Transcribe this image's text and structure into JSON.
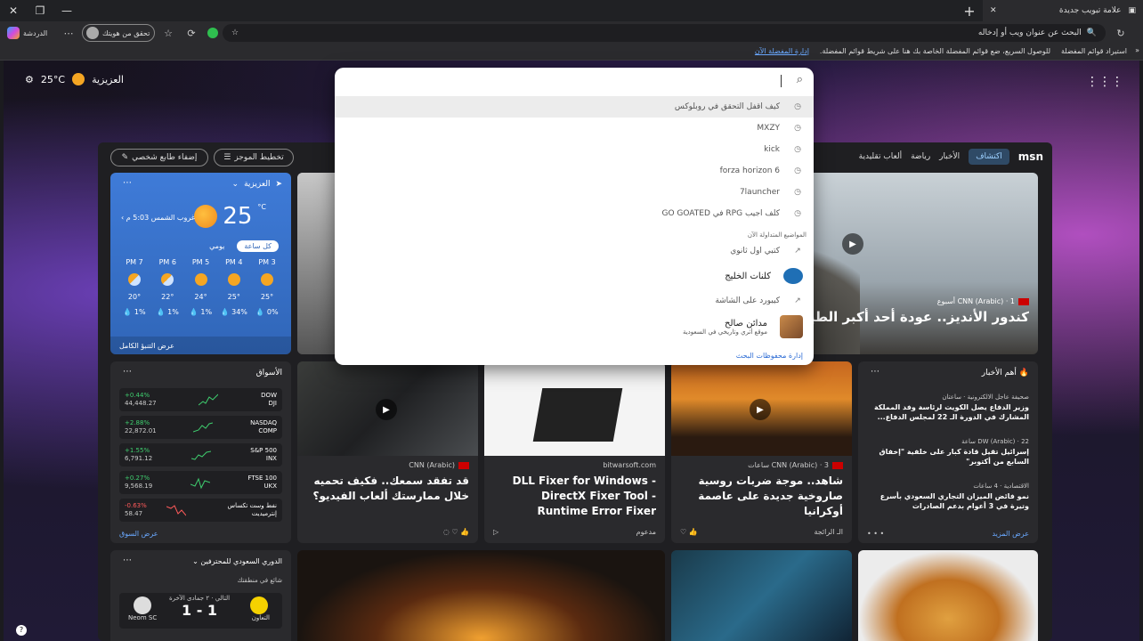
{
  "browser": {
    "tab_title": "علامة تبويب جديدة",
    "url_placeholder": "البحث عن عنوان ويب أو إدخاله",
    "profile_label": "تحقق من هويتك",
    "copilot_label": "الدردشة"
  },
  "favorites_bar": {
    "import_label": "استيراد قوائم المفضلة",
    "hint": "للوصول السريع، ضع قوائم المفضلة الخاصة بك هنا على شريط قوائم المفضلة.",
    "manage_link": "إدارة المفضلة الآن"
  },
  "header": {
    "city": "العزيزية",
    "temp": "25°C"
  },
  "feed": {
    "brand": "msn",
    "nav": [
      "اكتشاف",
      "الأخبار",
      "رياضة",
      "ألعاب تقليدية"
    ],
    "personalize_label": "إضفاء طابع شخصي",
    "layout_label": "تخطيط الموجز"
  },
  "weather": {
    "city": "العزيزية",
    "temp": "25",
    "unit": "°C",
    "sunset": "غروب الشمس 5:03 م",
    "tabs": [
      "كل ساعة",
      "يومي"
    ],
    "hours": [
      {
        "time": "3 PM",
        "temp": "25°",
        "rain": "0% 💧"
      },
      {
        "time": "4 PM",
        "temp": "25°",
        "rain": "34% 💧"
      },
      {
        "time": "5 PM",
        "temp": "24°",
        "rain": "1% 💧"
      },
      {
        "time": "6 PM",
        "temp": "22°",
        "rain": "1% 💧"
      },
      {
        "time": "7 PM",
        "temp": "20°",
        "rain": "1% 💧"
      }
    ],
    "footer": "عرض التنبؤ الكامل"
  },
  "hero": {
    "source": "CNN (Arabic) · 1 أسبوع",
    "title": "كندور الأنديز.. عودة أحد أكبر الطيور الـ"
  },
  "markets": {
    "title": "الأسواق",
    "rows": [
      {
        "name": "DOW",
        "sub": "DJI",
        "change": "+0.44%",
        "value": "44,448.27",
        "dir": "up"
      },
      {
        "name": "NASDAQ",
        "sub": "COMP",
        "change": "+2.88%",
        "value": "22,872.01",
        "dir": "up"
      },
      {
        "name": "S&P 500",
        "sub": "INX",
        "change": "+1.55%",
        "value": "6,791.12",
        "dir": "up"
      },
      {
        "name": "FTSE 100",
        "sub": "UKX",
        "change": "+0.27%",
        "value": "9,568.19",
        "dir": "up"
      },
      {
        "name": "نفط وست تكساس إنترميديت",
        "sub": "",
        "change": "-0.63%",
        "value": "58.47",
        "dir": "dn"
      }
    ],
    "footer": "عرض السوق"
  },
  "cards": [
    {
      "source": "CNN (Arabic)",
      "title": "قد تفقد سمعك.. فكيف تحميه خلال ممارستك ألعاب الفيديو؟",
      "foot": ""
    },
    {
      "source": "bitwarsoft.com",
      "title": "DLL Fixer for Windows - DirectX Fixer Tool - Runtime Error Fixer",
      "foot": "مدعوم"
    },
    {
      "source": "CNN (Arabic) · 3 ساعات",
      "title": "شاهد.. موجة ضربات روسية صاروخية جديدة على عاصمة أوكرانيا",
      "foot": "الـ الرائجة"
    }
  ],
  "top_news": {
    "title": "أهم الأخبار",
    "items": [
      {
        "source": "صحيفة عاجل الالكترونية · ساعتان",
        "title": "وزير الدفاع يصل الكويت لرئاسة وفد المملكة المشارك في الدورة الـ 22 لمجلس الدفاع..."
      },
      {
        "source": "DW (Arabic) · 22 ساعة",
        "title": "إسرائيل تقيل قادة كبار على خلفية \"إخفاق السابع من أكتوبر\""
      },
      {
        "source": "الاقتصادية · 4 ساعات",
        "title": "نمو فائض الميزان التجاري السعودي بأسرع وتيرة في 3 أعوام بدعم الصادرات"
      }
    ],
    "footer": "عرض المزيد"
  },
  "league": {
    "title": "الدوري السعودي للمحترفين",
    "subtitle": "شائع في منطقتك",
    "date": "التالي · ٢ جمادى الآخرة",
    "score": "1 - 1",
    "home": "التعاون",
    "away": "Neom SC"
  },
  "search_dropdown": {
    "items": [
      {
        "text": "كيف اقفل التحقق في روبلوكس",
        "icon": "history"
      },
      {
        "text": "MXZY",
        "icon": "history"
      },
      {
        "text": "kick",
        "icon": "history"
      },
      {
        "text": "forza horizon 6",
        "icon": "history"
      },
      {
        "text": "7launcher",
        "icon": "history"
      },
      {
        "text": "كلف اجيب RPG في GO GOATED",
        "icon": "history"
      }
    ],
    "trending_label": "المواضيع المتداولة الآن",
    "trending": [
      {
        "text": "كتبي اول ثانوي",
        "icon": "trend"
      },
      {
        "text": "كلنات الخليج",
        "icon": "logo"
      },
      {
        "text": "كيبورد على الشاشة",
        "icon": "trend"
      },
      {
        "text": "مدائن صالح",
        "sub": "موقع أثري وتاريخي في السعودية",
        "icon": "thumb"
      }
    ],
    "manage": "إدارة محفوظات البحث"
  },
  "colors": {
    "accent": "#6aa9ff",
    "weather_bg": "#3066b8",
    "up": "#3fcf6f",
    "down": "#ff5a5a"
  }
}
